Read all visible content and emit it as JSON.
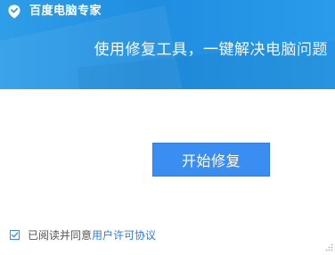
{
  "header": {
    "app_title": "百度电脑专家",
    "tagline": "使用修复工具，一键解决电脑问题",
    "logo_icon": "baidu-shield-logo-icon"
  },
  "main": {
    "start_button_label": "开始修复"
  },
  "agreement": {
    "checked": true,
    "text_prefix": "已阅读并同意",
    "link_label": "用户许可协议"
  },
  "colors": {
    "header_blue": "#1f8ee0",
    "button_blue": "#3a8ef2",
    "link_blue": "#2b7de0"
  }
}
